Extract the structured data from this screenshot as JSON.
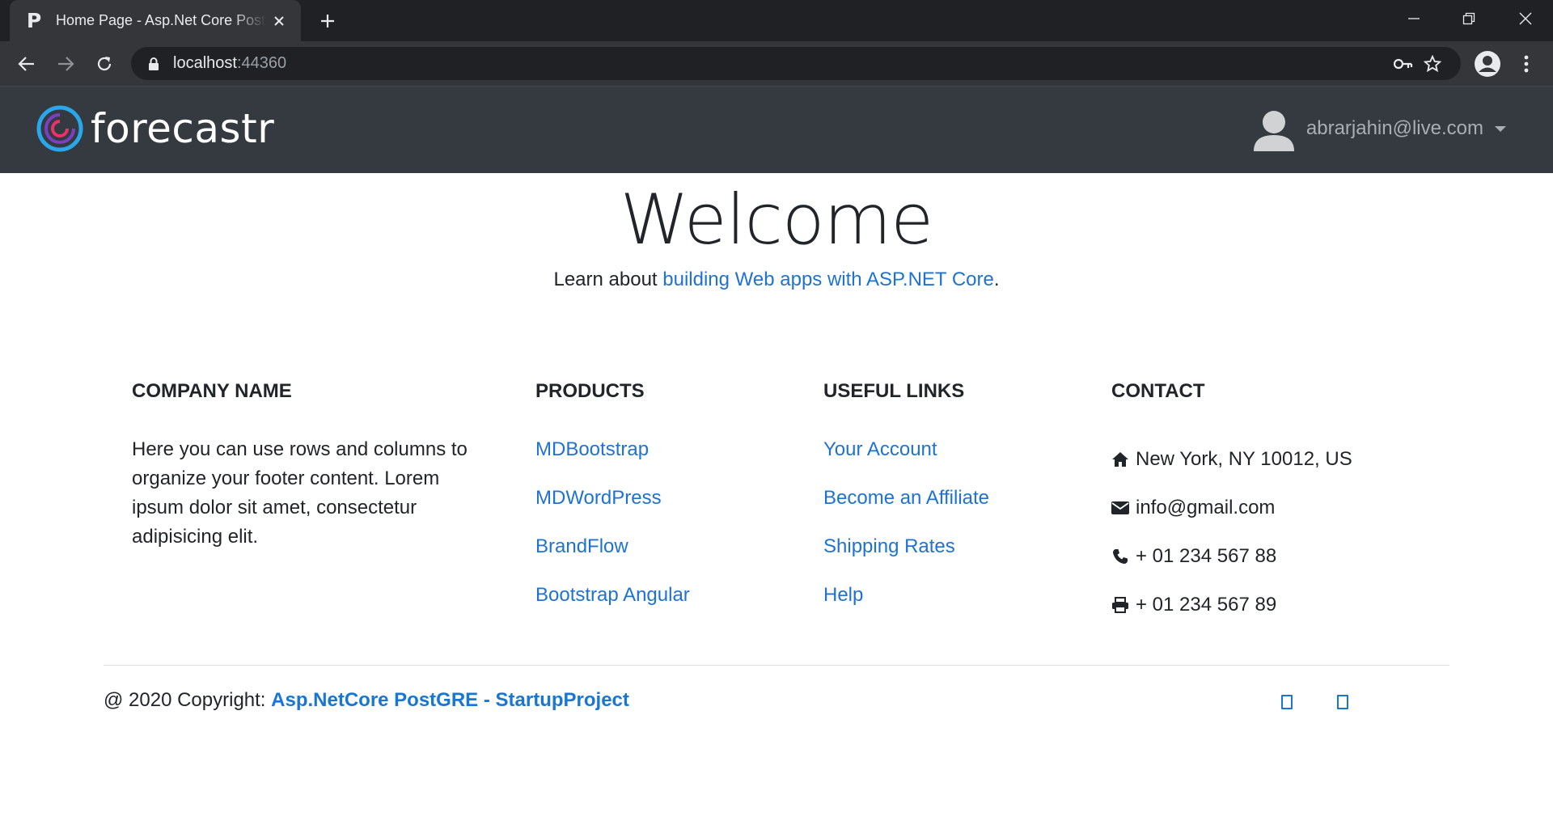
{
  "browser": {
    "tab_title": "Home Page - Asp.Net Core PostGRE",
    "favicon_letter": "P",
    "url_host": "localhost",
    "url_port": ":44360"
  },
  "navbar": {
    "brand": "forecastr",
    "user_email": "abrarjahin@live.com"
  },
  "main": {
    "title": "Welcome",
    "learn_prefix": "Learn about ",
    "learn_link": "building Web apps with ASP.NET Core",
    "learn_suffix": "."
  },
  "footer": {
    "company": {
      "heading": "COMPANY NAME",
      "text": "Here you can use rows and columns to organize your footer content. Lorem ipsum dolor sit amet, consectetur adipisicing elit."
    },
    "products": {
      "heading": "PRODUCTS",
      "items": [
        "MDBootstrap",
        "MDWordPress",
        "BrandFlow",
        "Bootstrap Angular"
      ]
    },
    "useful_links": {
      "heading": "USEFUL LINKS",
      "items": [
        "Your Account",
        "Become an Affiliate",
        "Shipping Rates",
        "Help"
      ]
    },
    "contact": {
      "heading": "CONTACT",
      "address": "New York, NY 10012, US",
      "email": "info@gmail.com",
      "phone": "+ 01 234 567 88",
      "fax": "+ 01 234 567 89"
    },
    "copyright_prefix": "@ 2020 Copyright: ",
    "copyright_link": "Asp.NetCore PostGRE - StartupProject"
  },
  "colors": {
    "navbar_bg": "#343a40",
    "link": "#1e73d2",
    "chrome_dark": "#202124",
    "chrome_toolbar": "#35363a"
  },
  "icons": [
    "close-icon",
    "plus-icon",
    "minimize-icon",
    "restore-icon",
    "back-arrow-icon",
    "forward-arrow-icon",
    "reload-icon",
    "lock-icon",
    "key-icon",
    "star-icon",
    "profile-icon",
    "kebab-menu-icon",
    "home-icon",
    "envelope-icon",
    "phone-icon",
    "printer-icon"
  ]
}
